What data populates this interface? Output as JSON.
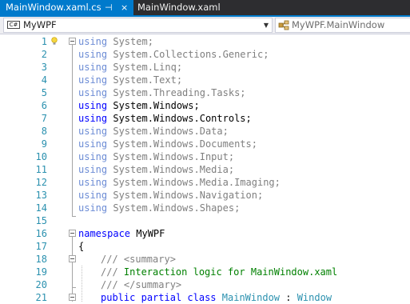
{
  "tabs": [
    {
      "label": "MainWindow.xaml.cs",
      "active": true,
      "pin": "⊣",
      "close": "×"
    },
    {
      "label": "MainWindow.xaml",
      "active": false
    }
  ],
  "navbar": {
    "left_badge": "C#",
    "left_value": "MyWPF",
    "right_value": "MyWPF.MainWindow"
  },
  "colors": {
    "accent": "#007acc",
    "keyword": "#0000ff",
    "type": "#2b91af",
    "comment": "#008000",
    "line_number": "#2b91af"
  },
  "editor": {
    "line_numbers": [
      "1",
      "2",
      "3",
      "4",
      "5",
      "6",
      "7",
      "8",
      "9",
      "10",
      "11",
      "12",
      "13",
      "14",
      "15",
      "16",
      "17",
      "18",
      "19",
      "20",
      "21"
    ],
    "lines": [
      {
        "kw": "using",
        "rest": " System;"
      },
      {
        "kw": "using",
        "rest": " System.Collections.Generic;"
      },
      {
        "kw": "using",
        "rest": " System.Linq;"
      },
      {
        "kw": "using",
        "rest": " System.Text;"
      },
      {
        "kw": "using",
        "rest": " System.Threading.Tasks;"
      },
      {
        "kw": "using",
        "rest": " System.Windows;"
      },
      {
        "kw": "using",
        "rest": " System.Windows.Controls;"
      },
      {
        "kw": "using",
        "rest": " System.Windows.Data;"
      },
      {
        "kw": "using",
        "rest": " System.Windows.Documents;"
      },
      {
        "kw": "using",
        "rest": " System.Windows.Input;"
      },
      {
        "kw": "using",
        "rest": " System.Windows.Media;"
      },
      {
        "kw": "using",
        "rest": " System.Windows.Media.Imaging;"
      },
      {
        "kw": "using",
        "rest": " System.Windows.Navigation;"
      },
      {
        "kw": "using",
        "rest": " System.Windows.Shapes;"
      },
      {
        "text": ""
      },
      {
        "kw": "namespace",
        "rest": " MyWPF"
      },
      {
        "text": "{"
      },
      {
        "prefix": "/// ",
        "tag": "<summary>"
      },
      {
        "prefix": "/// ",
        "comment": "Interaction logic for MainWindow.xaml"
      },
      {
        "prefix": "/// ",
        "tag": "</summary>"
      },
      {
        "kw1": "public",
        "kw2": "partial",
        "kw3": "class",
        "type1": "MainWindow",
        "sep": " : ",
        "type2": "Window"
      }
    ]
  }
}
